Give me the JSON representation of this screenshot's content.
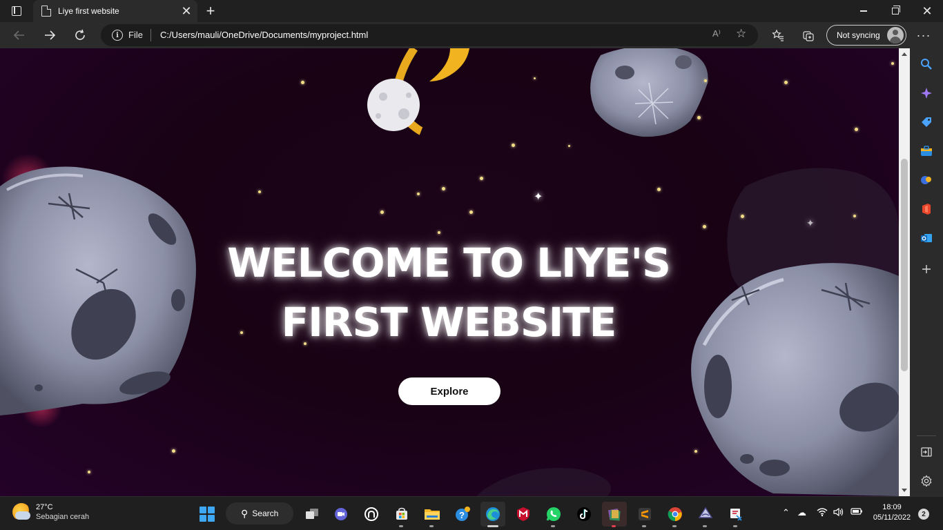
{
  "browser": {
    "tab_title": "Liye first website",
    "tab_close_glyph": "✕",
    "new_tab_glyph": "+",
    "address": {
      "scheme_label": "File",
      "url": "C:/Users/mauli/OneDrive/Documents/myproject.html",
      "read_aloud_glyph": "A⁾"
    },
    "sync_label": "Not syncing",
    "more_glyph": "···",
    "close_glyph": "✕"
  },
  "page": {
    "title_line1": "WELCOME TO LIYE'S",
    "title_line2": "FIRST WEBSITE",
    "explore_label": "Explore",
    "colors": {
      "background": "#1a0318",
      "star": "#f3dc86",
      "asteroid": "#8a8ea6",
      "button": "#ffffff"
    }
  },
  "sidebar": {
    "icons": [
      "search-icon",
      "copilot-icon",
      "shopping-tag-icon",
      "toolbox-icon",
      "games-icon",
      "office-icon",
      "outlook-icon",
      "add-icon",
      "sidebar-layout-icon",
      "settings-icon"
    ]
  },
  "taskbar": {
    "weather_temp": "27°C",
    "weather_condition": "Sebagian cerah",
    "search_label": "Search",
    "time": "18:09",
    "date": "05/11/2022",
    "notification_count": "2",
    "apps": [
      "start",
      "task-view",
      "teams-chat",
      "github-desktop",
      "microsoft-store",
      "file-explorer",
      "tips",
      "edge",
      "mcafee",
      "whatsapp",
      "tiktok",
      "winrar",
      "sublime-text",
      "chrome",
      "inkscape",
      "snipping-tool"
    ]
  }
}
